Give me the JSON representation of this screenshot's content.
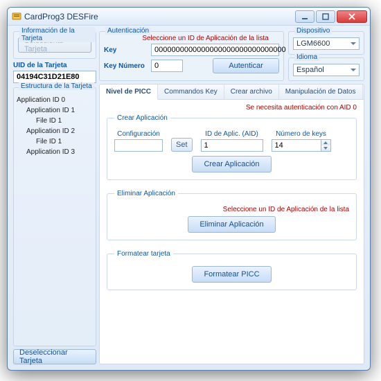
{
  "window": {
    "title": "CardProg3 DESFire"
  },
  "left": {
    "card_info_label": "Información de la Tarjeta",
    "select_card_btn": "Seleccionar Tarjeta",
    "uid_label": "UID de la Tarjeta",
    "uid_value": "04194C31D21E80",
    "structure_label": "Estructura de la Tarjeta",
    "tree": {
      "n0": "Application ID 0",
      "n0_0": "Application ID 1",
      "n0_0_0": "File ID 1",
      "n0_1": "Application ID 2",
      "n0_1_0": "File ID 1",
      "n0_2": "Application ID 3"
    },
    "deselect_btn": "Deseleccionar Tarjeta"
  },
  "auth": {
    "group_label": "Autenticación",
    "select_app_msg": "Seleccione un ID de Aplicación de la lista",
    "key_label": "Key",
    "key_value": "0000000000000000000000000000000",
    "keynum_label": "Key Número",
    "keynum_value": "0",
    "auth_btn": "Autenticar"
  },
  "device": {
    "group_label": "Dispositivo",
    "value": "LGM6600"
  },
  "language": {
    "group_label": "Idioma",
    "value": "Español"
  },
  "tabs": {
    "picc": "Nivel de PICC",
    "keys": "Commandos Key",
    "create": "Crear archivo",
    "data": "Manipulación de Datos"
  },
  "picc": {
    "auth_needed": "Se necesita autenticación con AID 0",
    "create_app": {
      "legend": "Crear Aplicación",
      "config_label": "Configuración",
      "config_value": "",
      "set_btn": "Set",
      "aid_label": "ID de Aplic. (AID)",
      "aid_value": "1",
      "num_keys_label": "Número de keys",
      "num_keys_value": "14",
      "create_btn": "Crear Aplicación"
    },
    "delete_app": {
      "legend": "Eliminar Aplicación",
      "msg": "Seleccione un ID de Aplicación de la lista",
      "delete_btn": "Eliminar Aplicación"
    },
    "format": {
      "legend": "Formatear tarjeta",
      "format_btn": "Formatear PICC"
    }
  }
}
